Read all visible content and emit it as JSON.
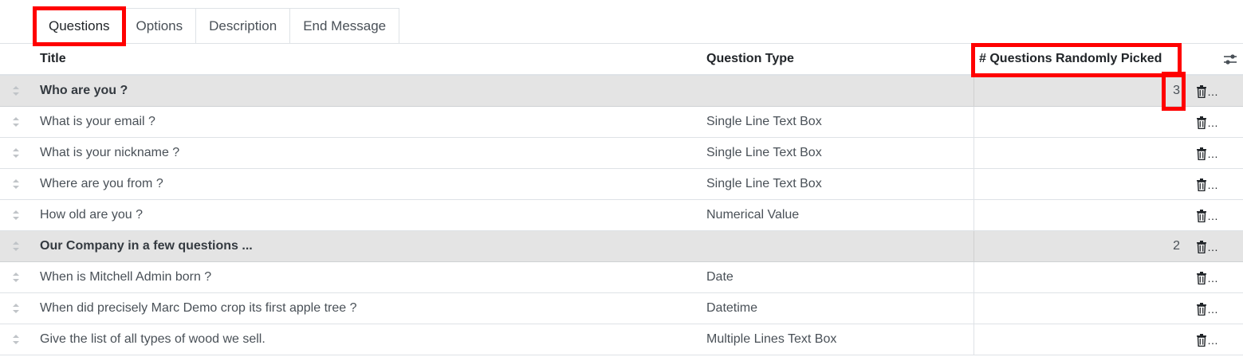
{
  "tabs": [
    {
      "label": "Questions",
      "active": true
    },
    {
      "label": "Options",
      "active": false
    },
    {
      "label": "Description",
      "active": false
    },
    {
      "label": "End Message",
      "active": false
    }
  ],
  "table": {
    "headers": {
      "title": "Title",
      "question_type": "Question Type",
      "random_count": "# Questions Randomly Picked"
    },
    "rows": [
      {
        "section": true,
        "title": "Who are you ?",
        "type": "",
        "count": "3"
      },
      {
        "section": false,
        "title": "What is your email ?",
        "type": "Single Line Text Box",
        "count": ""
      },
      {
        "section": false,
        "title": "What is your nickname ?",
        "type": "Single Line Text Box",
        "count": ""
      },
      {
        "section": false,
        "title": "Where are you from ?",
        "type": "Single Line Text Box",
        "count": ""
      },
      {
        "section": false,
        "title": "How old are you ?",
        "type": "Numerical Value",
        "count": ""
      },
      {
        "section": true,
        "title": "Our Company in a few questions ...",
        "type": "",
        "count": "2"
      },
      {
        "section": false,
        "title": "When is Mitchell Admin born ?",
        "type": "Date",
        "count": ""
      },
      {
        "section": false,
        "title": "When did precisely Marc Demo crop its first apple tree ?",
        "type": "Datetime",
        "count": ""
      },
      {
        "section": false,
        "title": "Give the list of all types of wood we sell.",
        "type": "Multiple Lines Text Box",
        "count": ""
      }
    ],
    "delete_label": "…"
  },
  "icons": {
    "handle": "drag-handle-icon",
    "delete": "trash-icon",
    "optional_columns": "sliders-icon"
  },
  "colors": {
    "highlight": "#ff0000",
    "section_bg": "#e4e4e4"
  }
}
